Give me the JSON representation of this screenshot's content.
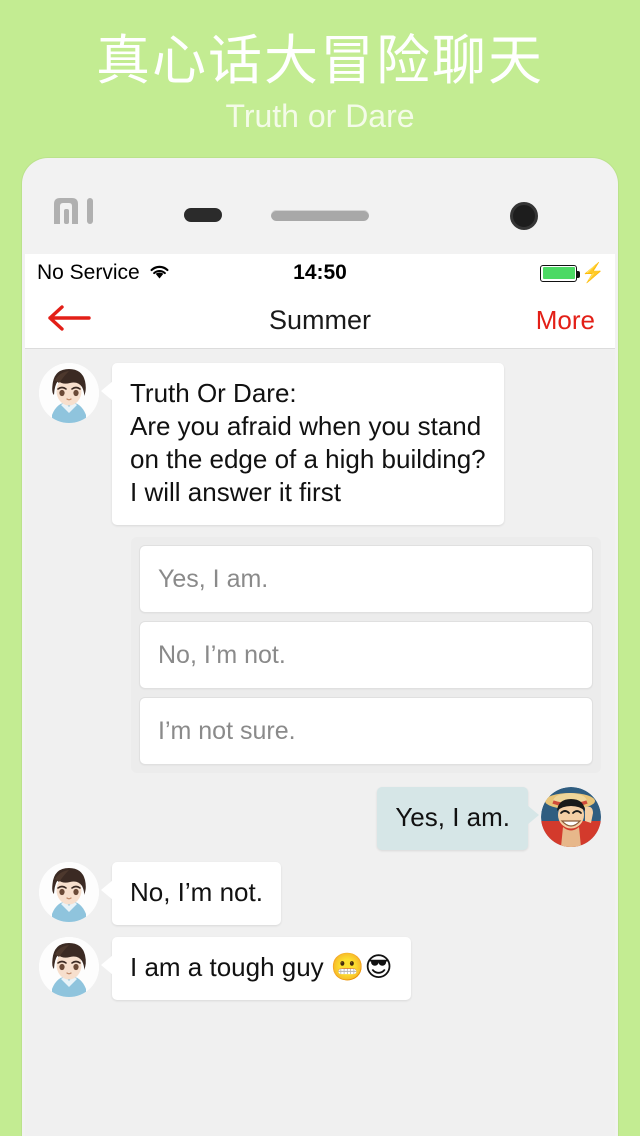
{
  "promo": {
    "title": "真心话大冒险聊天",
    "subtitle": "Truth or Dare",
    "background_color": "#c3ec92",
    "title_color": "#ffffff"
  },
  "phone": {
    "brand_logo": "mi-logo",
    "hardware": {
      "proximity_sensor": "proximity-sensor",
      "earpiece_speaker": "earpiece-speaker",
      "front_camera": "front-camera"
    }
  },
  "status_bar": {
    "carrier": "No Service",
    "wifi_icon": "wifi-icon",
    "time": "14:50",
    "battery_icon": "battery-icon",
    "battery_level_percent": 100,
    "battery_color": "#4cd964",
    "charging_icon": "⚡"
  },
  "nav_bar": {
    "back_icon": "back-arrow-icon",
    "title": "Summer",
    "more_label": "More",
    "accent_color": "#e31f17"
  },
  "chat": {
    "background_color": "#f0f0f0",
    "messages": [
      {
        "id": "msg-question",
        "direction": "incoming",
        "avatar": "boy-avatar",
        "lines": [
          "Truth Or Dare:",
          "Are you afraid when you stand",
          "on the edge of a high building?",
          "I will answer it first"
        ]
      },
      {
        "id": "msg-answer-yes",
        "direction": "outgoing",
        "avatar": "luffy-avatar",
        "lines": [
          "Yes, I am."
        ]
      },
      {
        "id": "msg-reply-no",
        "direction": "incoming",
        "avatar": "boy-avatar",
        "lines": [
          "No, I’m not."
        ]
      },
      {
        "id": "msg-reply-tough",
        "direction": "incoming",
        "avatar": "boy-avatar",
        "lines": [
          "I am a tough guy "
        ],
        "emoji": "😬😎"
      }
    ],
    "options": [
      {
        "id": "option-yes",
        "label": "Yes, I am."
      },
      {
        "id": "option-no",
        "label": "No, I’m not."
      },
      {
        "id": "option-unsure",
        "label": "I’m not sure."
      }
    ],
    "bubble_colors": {
      "incoming": "#ffffff",
      "outgoing": "#d6e6e7"
    }
  }
}
